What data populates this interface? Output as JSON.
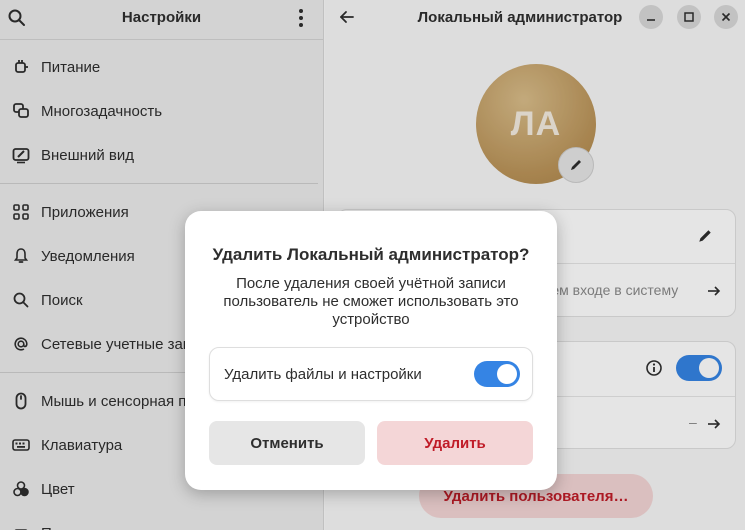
{
  "sidebar": {
    "title": "Настройки",
    "items": [
      {
        "label": "Питание",
        "icon": "power-plug-icon"
      },
      {
        "label": "Многозадачность",
        "icon": "multitasking-icon"
      },
      {
        "label": "Внешний вид",
        "icon": "appearance-icon"
      },
      {
        "label": "Приложения",
        "icon": "apps-grid-icon"
      },
      {
        "label": "Уведомления",
        "icon": "bell-icon"
      },
      {
        "label": "Поиск",
        "icon": "search-icon"
      },
      {
        "label": "Сетевые учетные записи",
        "icon": "at-sign-icon"
      },
      {
        "label": "Мышь и сенсорная панель",
        "icon": "mouse-icon"
      },
      {
        "label": "Клавиатура",
        "icon": "keyboard-icon"
      },
      {
        "label": "Цвет",
        "icon": "color-icon"
      },
      {
        "label": "П",
        "icon": "printer-icon"
      }
    ]
  },
  "main": {
    "title": "Локальный администратор",
    "avatar_initials": "ЛА",
    "autologin_hint": "щем входе в систему",
    "row_dash": "–",
    "delete_user_label": "Удалить пользователя…"
  },
  "dialog": {
    "title": "Удалить Локальный администратор?",
    "body": "После удаления своей учётной записи пользователь не сможет использовать это устройство",
    "toggle_label": "Удалить файлы и настройки",
    "toggle_on": true,
    "cancel_label": "Отменить",
    "delete_label": "Удалить"
  },
  "colors": {
    "accent": "#3584e4",
    "destructive": "#c01c28"
  }
}
